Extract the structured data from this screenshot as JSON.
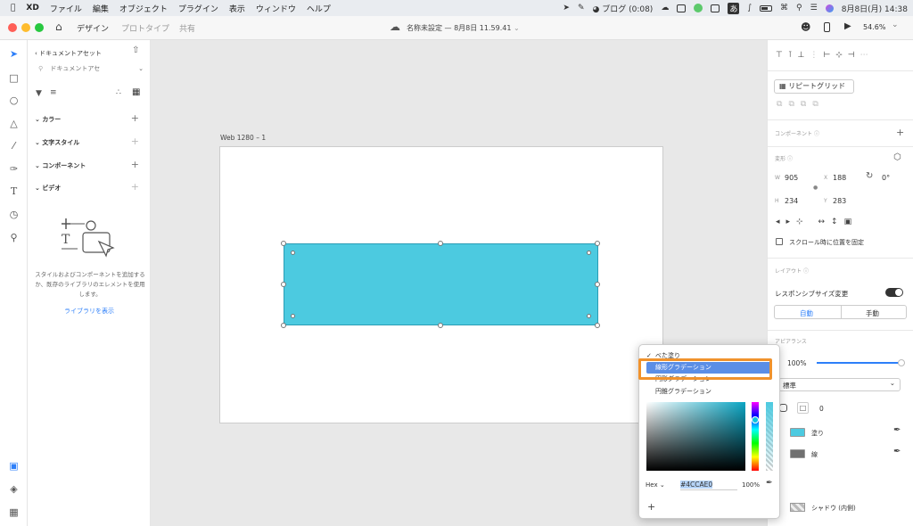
{
  "menubar": {
    "apple": "",
    "app": "XD",
    "items": [
      "ファイル",
      "編集",
      "オブジェクト",
      "プラグイン",
      "表示",
      "ウィンドウ",
      "ヘルプ"
    ],
    "blog_timer": "ブログ (0:08)",
    "ime": "あ",
    "clock": "8月8日(月) 14:38"
  },
  "titlebar": {
    "tabs": [
      "デザイン",
      "プロトタイプ",
      "共有"
    ],
    "doc_title": "名称未設定 — 8月8日 11.59.41",
    "zoom": "54.6%"
  },
  "leftpanel": {
    "back_label": "ドキュメントアセット",
    "search_placeholder": "ドキュメントアセ",
    "sections": [
      "カラー",
      "文字スタイル",
      "コンポーネント",
      "ビデオ"
    ],
    "empty_text": "スタイルおよびコンポーネントを追加するか、既存のライブラリのエレメントを使用します。",
    "show_library": "ライブラリを表示"
  },
  "canvas": {
    "artboard_label": "Web 1280 – 1"
  },
  "rightpanel": {
    "repeat_grid": "リピートグリッド",
    "component_label": "コンポーネント",
    "transform_label": "変形",
    "w_label": "W",
    "w_value": "905",
    "x_label": "X",
    "x_value": "188",
    "rotation": "0°",
    "h_label": "H",
    "h_value": "234",
    "y_label": "Y",
    "y_value": "283",
    "fix_scroll": "スクロール時に位置を固定",
    "layout_label": "レイアウト",
    "responsive": "レスポンシブサイズ変更",
    "auto": "自動",
    "manual": "手動",
    "appearance": "アピアランス",
    "opacity": "100%",
    "blend": "標準",
    "corner": "0",
    "fill_label": "塗り",
    "fill_color": "#4CCAE0",
    "stroke_label": "線",
    "stroke_color": "#707070",
    "shadow_label": "シャドウ (内側)"
  },
  "popup": {
    "options": [
      "べた塗り",
      "線形グラデーション",
      "円形グラデーション",
      "円錐グラデーション"
    ],
    "checked": "べた塗り",
    "format": "Hex",
    "hex": "#4CCAE0",
    "alpha": "100%",
    "add": "+"
  }
}
